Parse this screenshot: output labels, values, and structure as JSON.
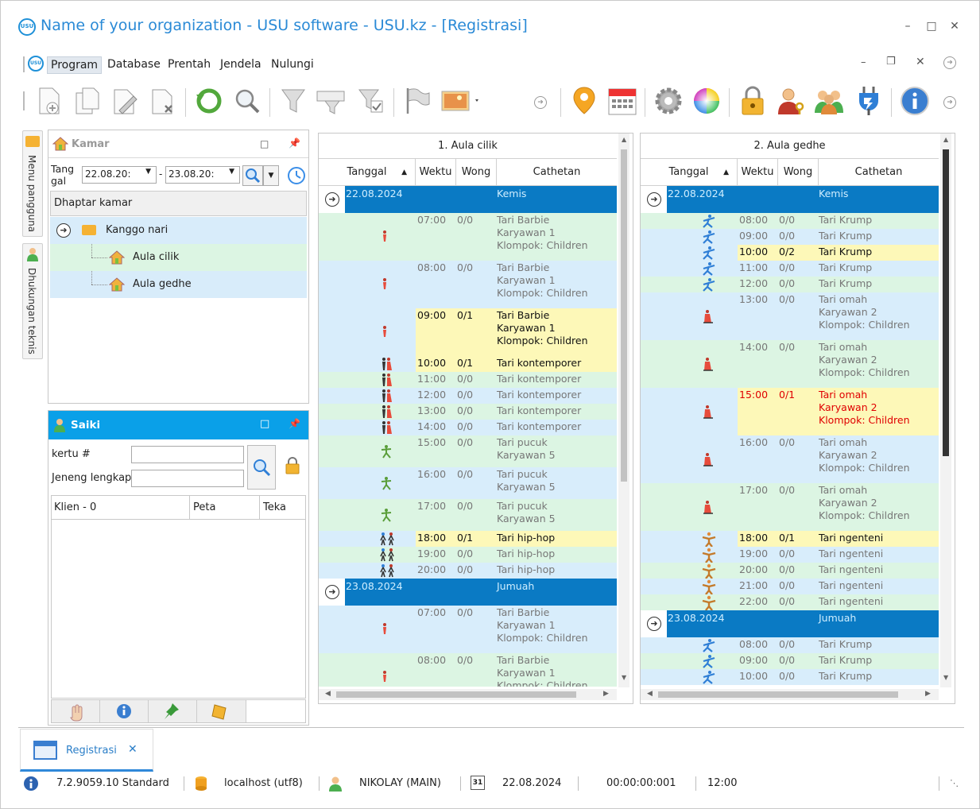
{
  "window": {
    "title": "Name of your organization - USU software - USU.kz - [Registrasi]",
    "logo_text": "USU"
  },
  "menu": {
    "items": [
      "Program",
      "Database",
      "Prentah",
      "Jendela",
      "Nulungi"
    ]
  },
  "sidetabs": {
    "menu": "Menu pangguna",
    "support": "Dhukungan teknis"
  },
  "kamar": {
    "title": "Kamar",
    "date_label": "Tang gal",
    "date_from": "22.08.20:",
    "date_to": "23.08.20:",
    "list_header": "Dhaptar kamar",
    "tree": [
      {
        "label": "Kanggo nari"
      },
      {
        "label": "Aula cilik"
      },
      {
        "label": "Aula gedhe"
      }
    ]
  },
  "saiki": {
    "title": "Saiki",
    "card_label": "kertu #",
    "name_label": "Jeneng lengkap",
    "col_client": "Klien - 0",
    "col_map": "Peta",
    "col_teka": "Teka"
  },
  "grid1": {
    "title": "1. Aula cilik",
    "cols": [
      "Tanggal",
      "Wektu",
      "Wong",
      "Cathetan"
    ],
    "rows": [
      {
        "type": "date",
        "date": "22.08.2024",
        "day": "Kemis"
      },
      {
        "type": "ev",
        "time": "07:00",
        "count": "0/0",
        "lines": [
          "Tari Barbie",
          "Karyawan 1",
          "Klompok: Children"
        ],
        "bg": "g",
        "icon": "i1"
      },
      {
        "type": "ev",
        "time": "08:00",
        "count": "0/0",
        "lines": [
          "Tari Barbie",
          "Karyawan 1",
          "Klompok: Children"
        ],
        "bg": "b",
        "icon": "i1"
      },
      {
        "type": "ev",
        "time": "09:00",
        "count": "0/1",
        "lines": [
          "Tari Barbie",
          "Karyawan 1",
          "Klompok: Children"
        ],
        "bg": "y",
        "icon": "i1"
      },
      {
        "type": "ev",
        "time": "10:00",
        "count": "0/1",
        "lines": [
          "Tari kontemporer"
        ],
        "bg": "y",
        "icon": "i2"
      },
      {
        "type": "ev",
        "time": "11:00",
        "count": "0/0",
        "lines": [
          "Tari kontemporer"
        ],
        "bg": "g",
        "icon": "i2"
      },
      {
        "type": "ev",
        "time": "12:00",
        "count": "0/0",
        "lines": [
          "Tari kontemporer"
        ],
        "bg": "b",
        "icon": "i2"
      },
      {
        "type": "ev",
        "time": "13:00",
        "count": "0/0",
        "lines": [
          "Tari kontemporer"
        ],
        "bg": "g",
        "icon": "i2"
      },
      {
        "type": "ev",
        "time": "14:00",
        "count": "0/0",
        "lines": [
          "Tari kontemporer"
        ],
        "bg": "b",
        "icon": "i2"
      },
      {
        "type": "ev",
        "time": "15:00",
        "count": "0/0",
        "lines": [
          "Tari pucuk",
          "Karyawan 5"
        ],
        "bg": "g",
        "icon": "i3"
      },
      {
        "type": "ev",
        "time": "16:00",
        "count": "0/0",
        "lines": [
          "Tari pucuk",
          "Karyawan 5"
        ],
        "bg": "b",
        "icon": "i3"
      },
      {
        "type": "ev",
        "time": "17:00",
        "count": "0/0",
        "lines": [
          "Tari pucuk",
          "Karyawan 5"
        ],
        "bg": "g",
        "icon": "i3"
      },
      {
        "type": "ev",
        "time": "18:00",
        "count": "0/1",
        "lines": [
          "Tari hip-hop"
        ],
        "bg": "y",
        "icon": "i4"
      },
      {
        "type": "ev",
        "time": "19:00",
        "count": "0/0",
        "lines": [
          "Tari hip-hop"
        ],
        "bg": "g",
        "icon": "i4"
      },
      {
        "type": "ev",
        "time": "20:00",
        "count": "0/0",
        "lines": [
          "Tari hip-hop"
        ],
        "bg": "b",
        "icon": "i4"
      },
      {
        "type": "date",
        "date": "23.08.2024",
        "day": "Jumuah"
      },
      {
        "type": "ev",
        "time": "07:00",
        "count": "0/0",
        "lines": [
          "Tari Barbie",
          "Karyawan 1",
          "Klompok: Children"
        ],
        "bg": "b",
        "icon": "i1"
      },
      {
        "type": "ev",
        "time": "08:00",
        "count": "0/0",
        "lines": [
          "Tari Barbie",
          "Karyawan 1",
          "Klompok: Children"
        ],
        "bg": "g",
        "icon": "i1"
      }
    ]
  },
  "grid2": {
    "title": "2. Aula gedhe",
    "cols": [
      "Tanggal",
      "Wektu",
      "Wong",
      "Cathetan"
    ],
    "rows": [
      {
        "type": "date",
        "date": "22.08.2024",
        "day": "Kemis"
      },
      {
        "type": "ev",
        "time": "08:00",
        "count": "0/0",
        "lines": [
          "Tari Krump"
        ],
        "bg": "g",
        "icon": "j1"
      },
      {
        "type": "ev",
        "time": "09:00",
        "count": "0/0",
        "lines": [
          "Tari Krump"
        ],
        "bg": "b",
        "icon": "j1"
      },
      {
        "type": "ev",
        "time": "10:00",
        "count": "0/2",
        "lines": [
          "Tari Krump"
        ],
        "bg": "y",
        "icon": "j1"
      },
      {
        "type": "ev",
        "time": "11:00",
        "count": "0/0",
        "lines": [
          "Tari Krump"
        ],
        "bg": "b",
        "icon": "j1"
      },
      {
        "type": "ev",
        "time": "12:00",
        "count": "0/0",
        "lines": [
          "Tari Krump"
        ],
        "bg": "g",
        "icon": "j1"
      },
      {
        "type": "ev",
        "time": "13:00",
        "count": "0/0",
        "lines": [
          "Tari omah",
          "Karyawan 2",
          "Klompok: Children"
        ],
        "bg": "b",
        "icon": "j2"
      },
      {
        "type": "ev",
        "time": "14:00",
        "count": "0/0",
        "lines": [
          "Tari omah",
          "Karyawan 2",
          "Klompok: Children"
        ],
        "bg": "g",
        "icon": "j2"
      },
      {
        "type": "ev",
        "time": "15:00",
        "count": "0/1",
        "lines": [
          "Tari omah",
          "Karyawan 2",
          "Klompok: Children"
        ],
        "bg": "y",
        "icon": "j2",
        "red": true
      },
      {
        "type": "ev",
        "time": "16:00",
        "count": "0/0",
        "lines": [
          "Tari omah",
          "Karyawan 2",
          "Klompok: Children"
        ],
        "bg": "b",
        "icon": "j2"
      },
      {
        "type": "ev",
        "time": "17:00",
        "count": "0/0",
        "lines": [
          "Tari omah",
          "Karyawan 2",
          "Klompok: Children"
        ],
        "bg": "g",
        "icon": "j2"
      },
      {
        "type": "ev",
        "time": "18:00",
        "count": "0/1",
        "lines": [
          "Tari ngenteni"
        ],
        "bg": "y",
        "icon": "j3"
      },
      {
        "type": "ev",
        "time": "19:00",
        "count": "0/0",
        "lines": [
          "Tari ngenteni"
        ],
        "bg": "b",
        "icon": "j3"
      },
      {
        "type": "ev",
        "time": "20:00",
        "count": "0/0",
        "lines": [
          "Tari ngenteni"
        ],
        "bg": "g",
        "icon": "j3"
      },
      {
        "type": "ev",
        "time": "21:00",
        "count": "0/0",
        "lines": [
          "Tari ngenteni"
        ],
        "bg": "b",
        "icon": "j3"
      },
      {
        "type": "ev",
        "time": "22:00",
        "count": "0/0",
        "lines": [
          "Tari ngenteni"
        ],
        "bg": "g",
        "icon": "j3"
      },
      {
        "type": "date",
        "date": "23.08.2024",
        "day": "Jumuah"
      },
      {
        "type": "ev",
        "time": "08:00",
        "count": "0/0",
        "lines": [
          "Tari Krump"
        ],
        "bg": "b",
        "icon": "j1"
      },
      {
        "type": "ev",
        "time": "09:00",
        "count": "0/0",
        "lines": [
          "Tari Krump"
        ],
        "bg": "g",
        "icon": "j1"
      },
      {
        "type": "ev",
        "time": "10:00",
        "count": "0/0",
        "lines": [
          "Tari Krump"
        ],
        "bg": "b",
        "icon": "j1"
      }
    ]
  },
  "doc_tab": {
    "label": "Registrasi"
  },
  "status": {
    "version": "7.2.9059.10 Standard",
    "db": "localhost (utf8)",
    "user": "NIKOLAY (MAIN)",
    "cal_day": "31",
    "date": "22.08.2024",
    "timer": "00:00:00:001",
    "time": "12:00"
  },
  "colors": {
    "accent": "#0a7ac4",
    "green_row": "#dcf5e3",
    "blue_row": "#d8edfb",
    "yellow_row": "#fdf8b8",
    "red_text": "#e00000"
  }
}
